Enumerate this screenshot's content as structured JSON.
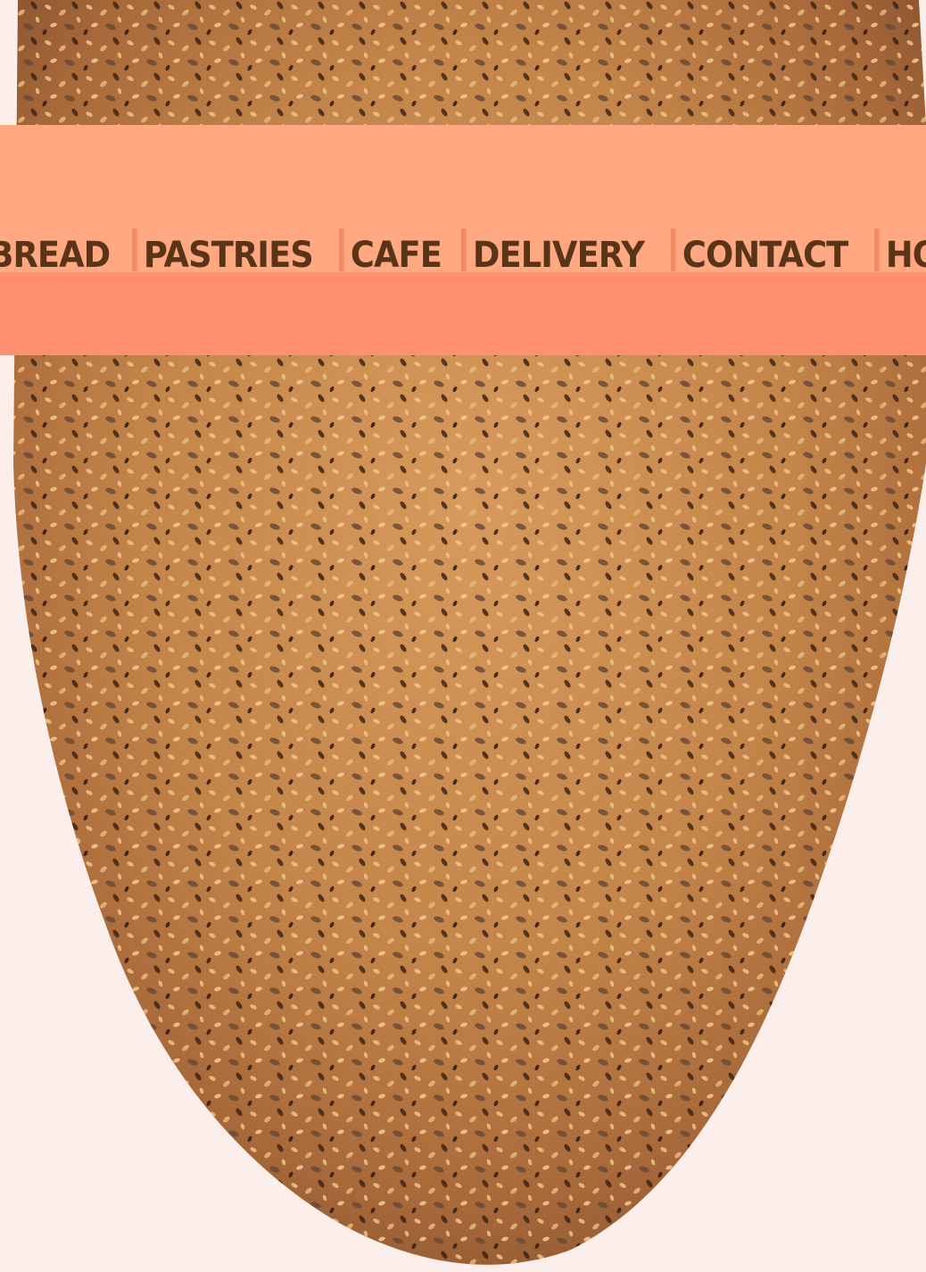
{
  "nav": {
    "items": [
      {
        "label": "BREAD"
      },
      {
        "label": "PASTRIES"
      },
      {
        "label": "CAFE"
      },
      {
        "label": "DELIVERY"
      },
      {
        "label": "CONTACT"
      },
      {
        "label": "HOME"
      }
    ]
  },
  "colors": {
    "header_top": "#ffa881",
    "header_bottom": "#ff9170",
    "nav_text": "#5a3417",
    "nav_divider": "#ef8a63",
    "background": "#fcefeb",
    "bread_crust": "#c98a4c"
  },
  "hero_image": {
    "subject": "seeded-bread-loaf"
  }
}
